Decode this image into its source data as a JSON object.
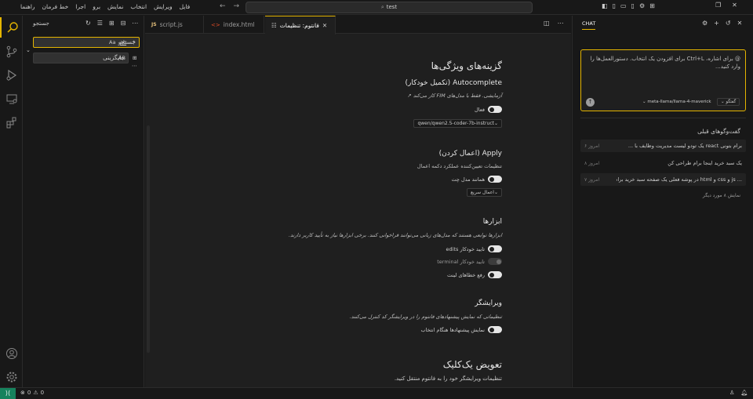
{
  "titlebar": {
    "menu": [
      "فایل",
      "ویرایش",
      "انتخاب",
      "نمایش",
      "برو",
      "اجرا",
      "خط فرمان",
      "راهنما"
    ],
    "search_text": "test"
  },
  "sidebar": {
    "title": "جستجو",
    "search_value": "جستجو",
    "replace_value": "جایگزینی",
    "match_case": "Aa",
    "whole_word": "ab",
    "regex": ".*",
    "preserve_case": "AB"
  },
  "tabs": [
    {
      "label": "script.js",
      "icon": "js-file-icon"
    },
    {
      "label": "index.html",
      "icon": "html-file-icon"
    },
    {
      "label": "فانتوم: تنظیمات",
      "icon": "settings-tab-icon"
    }
  ],
  "settings": {
    "features_title": "گزینه‌های ویژگی‌ها",
    "autocomplete": {
      "title": "Autocomplete (تکمیل خودکار)",
      "desc": "آزمایشی. فقط با مدل‌های FIM کار می‌کند ↗",
      "toggle_label": "فعال",
      "model": "qwen/qwen2.5-coder-7b-instruct"
    },
    "apply": {
      "title": "Apply (اعمال کردن)",
      "desc": "تنظیمات تعیین‌کننده عملکرد دکمه اعمال",
      "toggle_label": "همانند مدل چت",
      "mode": "اعمال سریع"
    },
    "tools": {
      "title": "ابزارها",
      "desc": "ابزارها توابعی هستند که مدل‌های زبانی می‌توانند فراخوانی کنند. برخی ابزارها نیاز به تأیید کاربر دارند.",
      "items": [
        {
          "label": "تایید خودکار edits",
          "on": true
        },
        {
          "label": "تایید خودکار terminal",
          "on": false
        },
        {
          "label": "رفع خطاهای لینت",
          "on": true
        }
      ]
    },
    "editor": {
      "title": "ویرایشگر",
      "desc": "تنظیماتی که نمایش پیشنهادهای فانتوم را در ویرایشگر کد کنترل می‌کنند.",
      "toggle_label": "نمایش پیشنهادها هنگام انتخاب"
    },
    "oneclick": {
      "title": "تعویض یک‌کلیک",
      "desc": "تنظیمات ویرایشگر خود را به فانتوم منتقل کنید."
    }
  },
  "chat": {
    "tab_label": "CHAT",
    "placeholder": "@ برای اشاره، Ctrl+L برای افزودن یک انتخاب. دستورالعمل‌ها را وارد کنید...",
    "model": "meta-llama/llama-4-maverick",
    "mode": "گفتگو",
    "previous_title": "گفت‌وگوهای قبلی",
    "threads": [
      {
        "title": "برام بتونی react یک تودو لیست مدیریت وظایف با ...",
        "date": "امروز ۶"
      },
      {
        "title": "یک سبد خرید اینجا برام طراحی کن",
        "date": "امروز ۸"
      },
      {
        "title": "... js و css و html در پوشه فعلی یک صفحه سبد خرید برام بساز همه",
        "date": "امروز ۷"
      }
    ],
    "show_more": "نمایش ۸ مورد دیگر"
  },
  "statusbar": {
    "errors": "0",
    "warnings": "0"
  },
  "colors": {
    "accent": "#e5b500",
    "background": "#1f1f1f",
    "panel": "#181818"
  }
}
